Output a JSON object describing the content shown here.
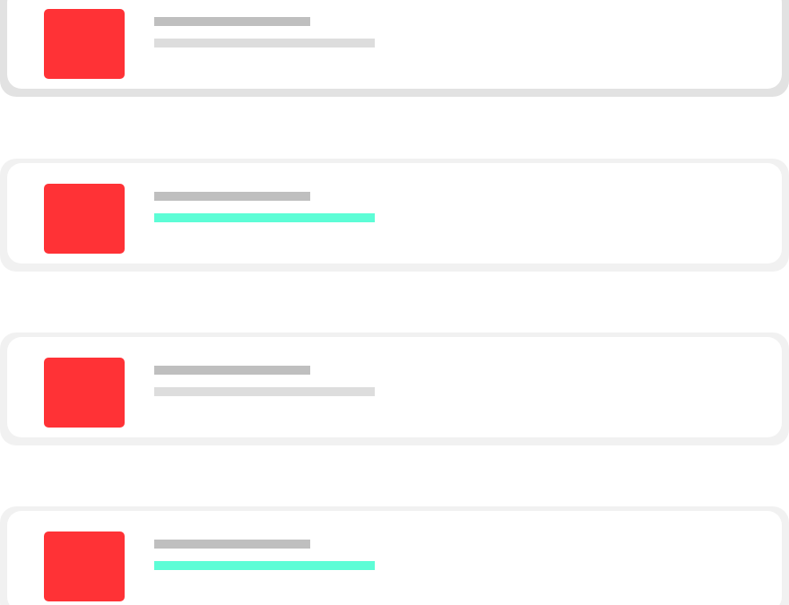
{
  "colors": {
    "thumbnail": "#ff3236",
    "title_line": "#bfbfbf",
    "subtitle_line_default": "#dddddd",
    "subtitle_line_highlight": "#5dfdd6",
    "card_border": "#f1f1f1",
    "card_border_selected": "#e2e2e2"
  },
  "list": {
    "items": [
      {
        "selected": true,
        "highlighted": false
      },
      {
        "selected": false,
        "highlighted": true
      },
      {
        "selected": false,
        "highlighted": false
      },
      {
        "selected": false,
        "highlighted": true
      }
    ]
  }
}
